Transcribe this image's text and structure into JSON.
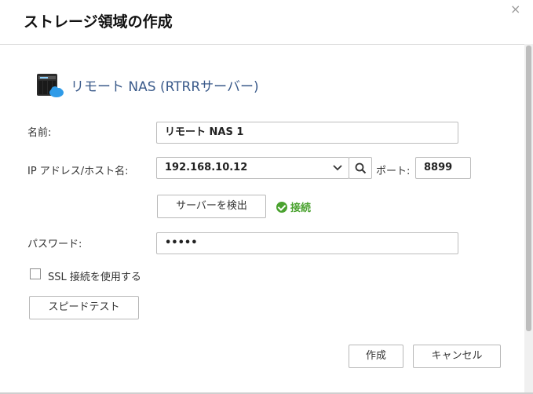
{
  "dialog": {
    "title": "ストレージ領域の作成",
    "close_label": "×"
  },
  "header": {
    "nas_title": "リモート NAS (RTRRサーバー)"
  },
  "form": {
    "name_label": "名前:",
    "name_value": "リモート NAS 1",
    "ip_label": "IP アドレス/ホスト名:",
    "ip_value": "192.168.10.12",
    "port_label": "ポート:",
    "port_value": "8899",
    "detect_button": "サーバーを検出",
    "status_text": "接続",
    "password_label": "パスワード:",
    "password_value": "•••••",
    "ssl_label": "SSL 接続を使用する",
    "ssl_checked": false,
    "speed_test_button": "スピードテスト"
  },
  "footer": {
    "create_button": "作成",
    "cancel_button": "キャンセル"
  },
  "colors": {
    "accent_title": "#3a5a8a",
    "status_ok": "#4aa22f"
  }
}
